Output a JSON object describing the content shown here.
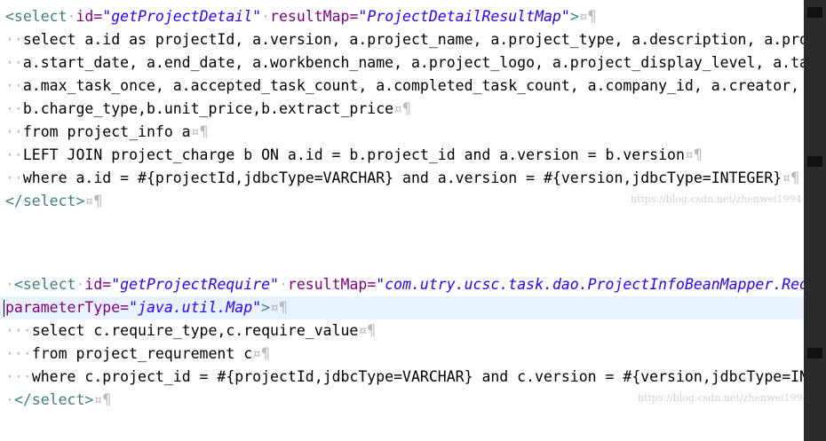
{
  "block1": {
    "line1": {
      "open": "<select",
      "ws1": "·",
      "id_attr": "id=",
      "id_val": "\"getProjectDetail\"",
      "ws2": "·",
      "rm_attr": "resultMap=",
      "rm_val": "\"ProjectDetailResultMap\"",
      "close": ">",
      "eol": "¤¶"
    },
    "line2": {
      "ind": "··",
      "text": "select a.id as projectId, a.version, a.project_name, a.project_type, a.description, a.project_status, a.p"
    },
    "line3": {
      "ind": "··",
      "text": "a.start_date, a.end_date, a.workbench_name, a.project_logo, a.project_display_level, a.task_total, ",
      "eol": "¤¶"
    },
    "line4": {
      "ind": "··",
      "text": "a.max_task_once, a.accepted_task_count, a.completed_task_count, a.company_id, a.creator, a.create_date, a"
    },
    "line5": {
      "ind": "··",
      "text": "b.charge_type,b.unit_price,b.extract_price",
      "eol": "¤¶"
    },
    "line6": {
      "ind": "··",
      "text": "from project_info a",
      "eol": "¤¶"
    },
    "line7": {
      "ind": "··",
      "text": "LEFT JOIN project_charge b ON a.id = b.project_id and a.version = b.version",
      "eol": "¤¶"
    },
    "line8": {
      "ind": "··",
      "text": "where a.id = #{projectId,jdbcType=VARCHAR} and a.version = #{version,jdbcType=INTEGER}",
      "eol": "¤¶"
    },
    "line9": {
      "close_tag": "</select>",
      "eol": "¤¶"
    },
    "watermark": "https://blog.csdn.net/zhenwei1994"
  },
  "block2": {
    "line1": {
      "ind": "·",
      "open": "<select",
      "ws1": "·",
      "id_attr": "id=",
      "id_val": "\"getProjectRequire\"",
      "ws2": "·",
      "rm_attr": "resultMap=",
      "rm_val": "\"com.utry.ucsc.task.dao.ProjectInfoBeanMapper.RequiresResultMap\"",
      "eol": "·¤¶"
    },
    "line2": {
      "pt_attr": "parameterType=",
      "pt_val": "\"java.util.Map\"",
      "close": ">",
      "eol": "¤¶"
    },
    "line3": {
      "ind": "···",
      "text": "select c.require_type,c.require_value",
      "eol": "¤¶"
    },
    "line4": {
      "ind": "···",
      "text": "from project_requrement c",
      "eol": "¤¶"
    },
    "line5": {
      "ind": "···",
      "text": "where c.project_id = #{projectId,jdbcType=VARCHAR} and c.version = #{version,jdbcType=INTEGER}",
      "eol": "¤¶"
    },
    "line6": {
      "ind": "·",
      "close_tag": "</select>",
      "eol": "¤¶"
    },
    "watermark": "https://blog.csdn.net/zhenwei1994"
  },
  "colors": {
    "tag": "#3f7f7f",
    "attr": "#7f007f",
    "value": "#2a00ff",
    "whitespace": "#b9b9b9",
    "current_line": "#e8f2fe"
  }
}
